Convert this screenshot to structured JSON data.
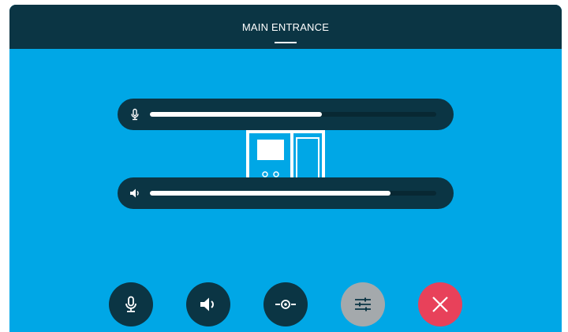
{
  "header": {
    "title": "MAIN ENTRANCE"
  },
  "sliders": {
    "microphone": {
      "icon": "microphone-icon",
      "level": 0.6
    },
    "speaker": {
      "icon": "speaker-icon",
      "level": 0.84
    }
  },
  "device": {
    "icon": "intercom-panel-icon"
  },
  "controls": [
    {
      "name": "microphone-button",
      "icon": "microphone-icon"
    },
    {
      "name": "speaker-button",
      "icon": "speaker-icon"
    },
    {
      "name": "door-open-button",
      "icon": "door-release-icon"
    },
    {
      "name": "settings-button",
      "icon": "sliders-icon"
    },
    {
      "name": "hang-up-button",
      "icon": "close-icon"
    }
  ],
  "colors": {
    "background": "#00a7e6",
    "dark": "#0b3544",
    "settings_button": "#a4a9ac",
    "hang_up_button": "#e8415a"
  }
}
